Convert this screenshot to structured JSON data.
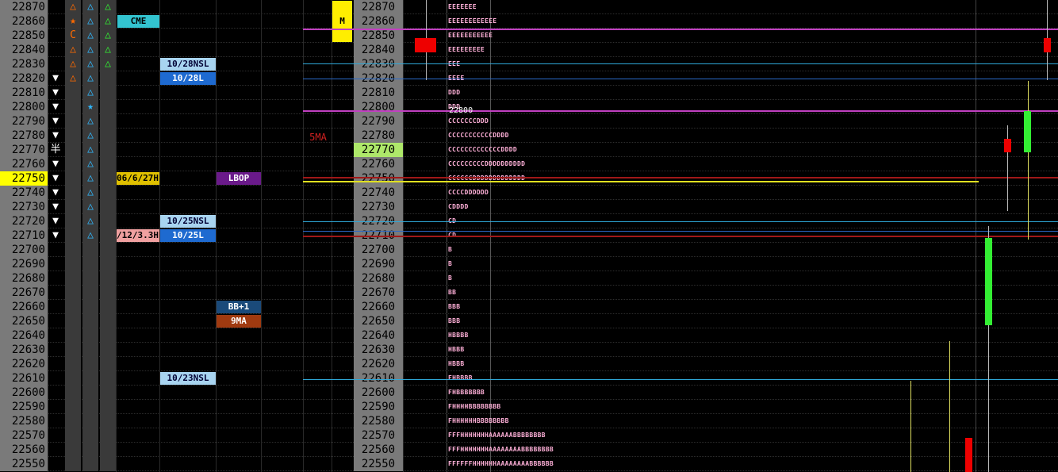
{
  "prices": [
    "22870",
    "22860",
    "22850",
    "22840",
    "22830",
    "22820",
    "22810",
    "22800",
    "22790",
    "22780",
    "22770",
    "22760",
    "22750",
    "22740",
    "22730",
    "22720",
    "22710",
    "22700",
    "22690",
    "22680",
    "22670",
    "22660",
    "22650",
    "22640",
    "22630",
    "22620",
    "22610",
    "22600",
    "22590",
    "22580",
    "22570",
    "22560",
    "22550"
  ],
  "highlight_left": "22750",
  "highlight_right": "22770",
  "col1_marks": {
    "5": "▼",
    "6": "▼",
    "7": "▼",
    "8": "▼",
    "9": "▼",
    "10": "半",
    "11": "▼",
    "12": "▼",
    "13": "▼",
    "14": "▼",
    "15": "▼",
    "16": "▼"
  },
  "col2_marks": {
    "0": "△",
    "1": "★",
    "2": "C",
    "3": "△",
    "4": "△",
    "5": "△"
  },
  "col3_marks": {
    "0": "△",
    "1": "△",
    "2": "△",
    "3": "△",
    "4": "△",
    "5": "△",
    "6": "△",
    "7": "★",
    "8": "△",
    "9": "△",
    "10": "△",
    "11": "△",
    "12": "△",
    "13": "△",
    "14": "△",
    "15": "△",
    "16": "△"
  },
  "col4_marks": {
    "0": "△",
    "1": "△",
    "2": "△",
    "3": "△",
    "4": "△"
  },
  "tags": {
    "cme": "CME",
    "nsl_1028": "10/28NSL",
    "l_1028": "10/28L",
    "date_a": "06/6/27H",
    "lbop": "LBOP",
    "nsl_1025": "10/25NSL",
    "date_b": "/12/3.3H",
    "l_1025": "10/25L",
    "bb1": "BB+1",
    "ma9": "9MA",
    "nsl_1023": "10/23NSL",
    "m_marker": "M",
    "ma5": "5MA",
    "line_label": "22800"
  },
  "tpo": [
    "EEEEEEE",
    "EEEEEEEEEEEE",
    "EEEEEEEEEEE",
    "EEEEEEEEE",
    "EEE",
    "EEEE",
    "DDD",
    "DDD",
    "CCCCCCCDDD",
    "CCCCCCCCCCCDDDD",
    "CCCCCCCCCCCCCDDDD",
    "CCCCCCCCCDDDDDDDDDD",
    "CCCCCCDDDDDDDDDDDDD",
    "CCCCDDDDDD",
    "CDDDD",
    "CD",
    "CD",
    "B",
    "B",
    "B",
    "BB",
    "BBB",
    "BBB",
    "HBBBB",
    "HBBB",
    "HBBB",
    "FHBBBB",
    "FHBBBBBBB",
    "FHHHHBBBBBBBB",
    "FHHHHHHBBBBBBBB",
    "FFFHHHHHHHAAAAAABBBBBBBB",
    "FFFHHHHHHHAAAAAAAABBBBBBBB",
    "FFFFFFHHHHHHAAAAAAAABBBBBB"
  ],
  "colors": {
    "bg": "#000000",
    "price_bg": "#7a7a7a",
    "highlight_yellow": "#ffff00",
    "highlight_green": "#aee86a",
    "magenta": "#d040d0",
    "cyan": "#2fa8d8",
    "red_line": "#b02020",
    "yellow_line": "#e0e020",
    "candle_red": "#ee0000",
    "candle_green": "#33ee33",
    "tpo_pink": "#ffb0d8"
  }
}
